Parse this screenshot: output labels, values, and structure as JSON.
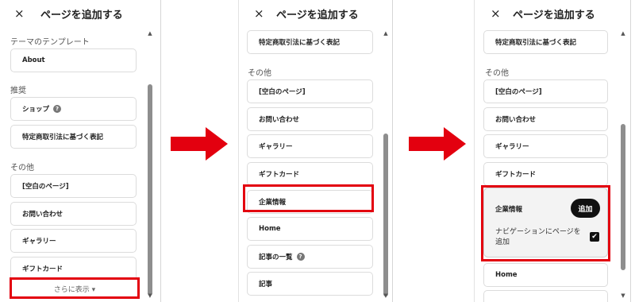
{
  "panels": [
    {
      "title": "ページを追加する",
      "close_icon": "×",
      "sections": [
        "テーマのテンプレート",
        "推奨",
        "その他"
      ],
      "items": [
        "About",
        "ショップ",
        "特定商取引法に基づく表記",
        "[空白のページ]",
        "お問い合わせ",
        "ギャラリー",
        "ギフトカード"
      ],
      "more_label": "さらに表示 ▾"
    },
    {
      "title": "ページを追加する",
      "close_icon": "×",
      "sections": [
        "その他"
      ],
      "items": [
        "特定商取引法に基づく表記",
        "[空白のページ]",
        "お問い合わせ",
        "ギャラリー",
        "ギフトカード",
        "企業情報",
        "Home",
        "記事の一覧",
        "記事"
      ]
    },
    {
      "title": "ページを追加する",
      "close_icon": "×",
      "sections": [
        "その他"
      ],
      "items": [
        "特定商取引法に基づく表記",
        "[空白のページ]",
        "お問い合わせ",
        "ギャラリー",
        "ギフトカード",
        "Home"
      ],
      "expanded": {
        "name": "企業情報",
        "add_label": "追加",
        "option_label": "ナビゲーションにページを追加",
        "checked_mark": "✔"
      }
    }
  ],
  "icons": {
    "help": "?",
    "scroll_up": "▲",
    "scroll_down": "▼"
  },
  "colors": {
    "highlight": "#e3000f",
    "arrow": "#e3000f",
    "primary_button": "#111111"
  }
}
